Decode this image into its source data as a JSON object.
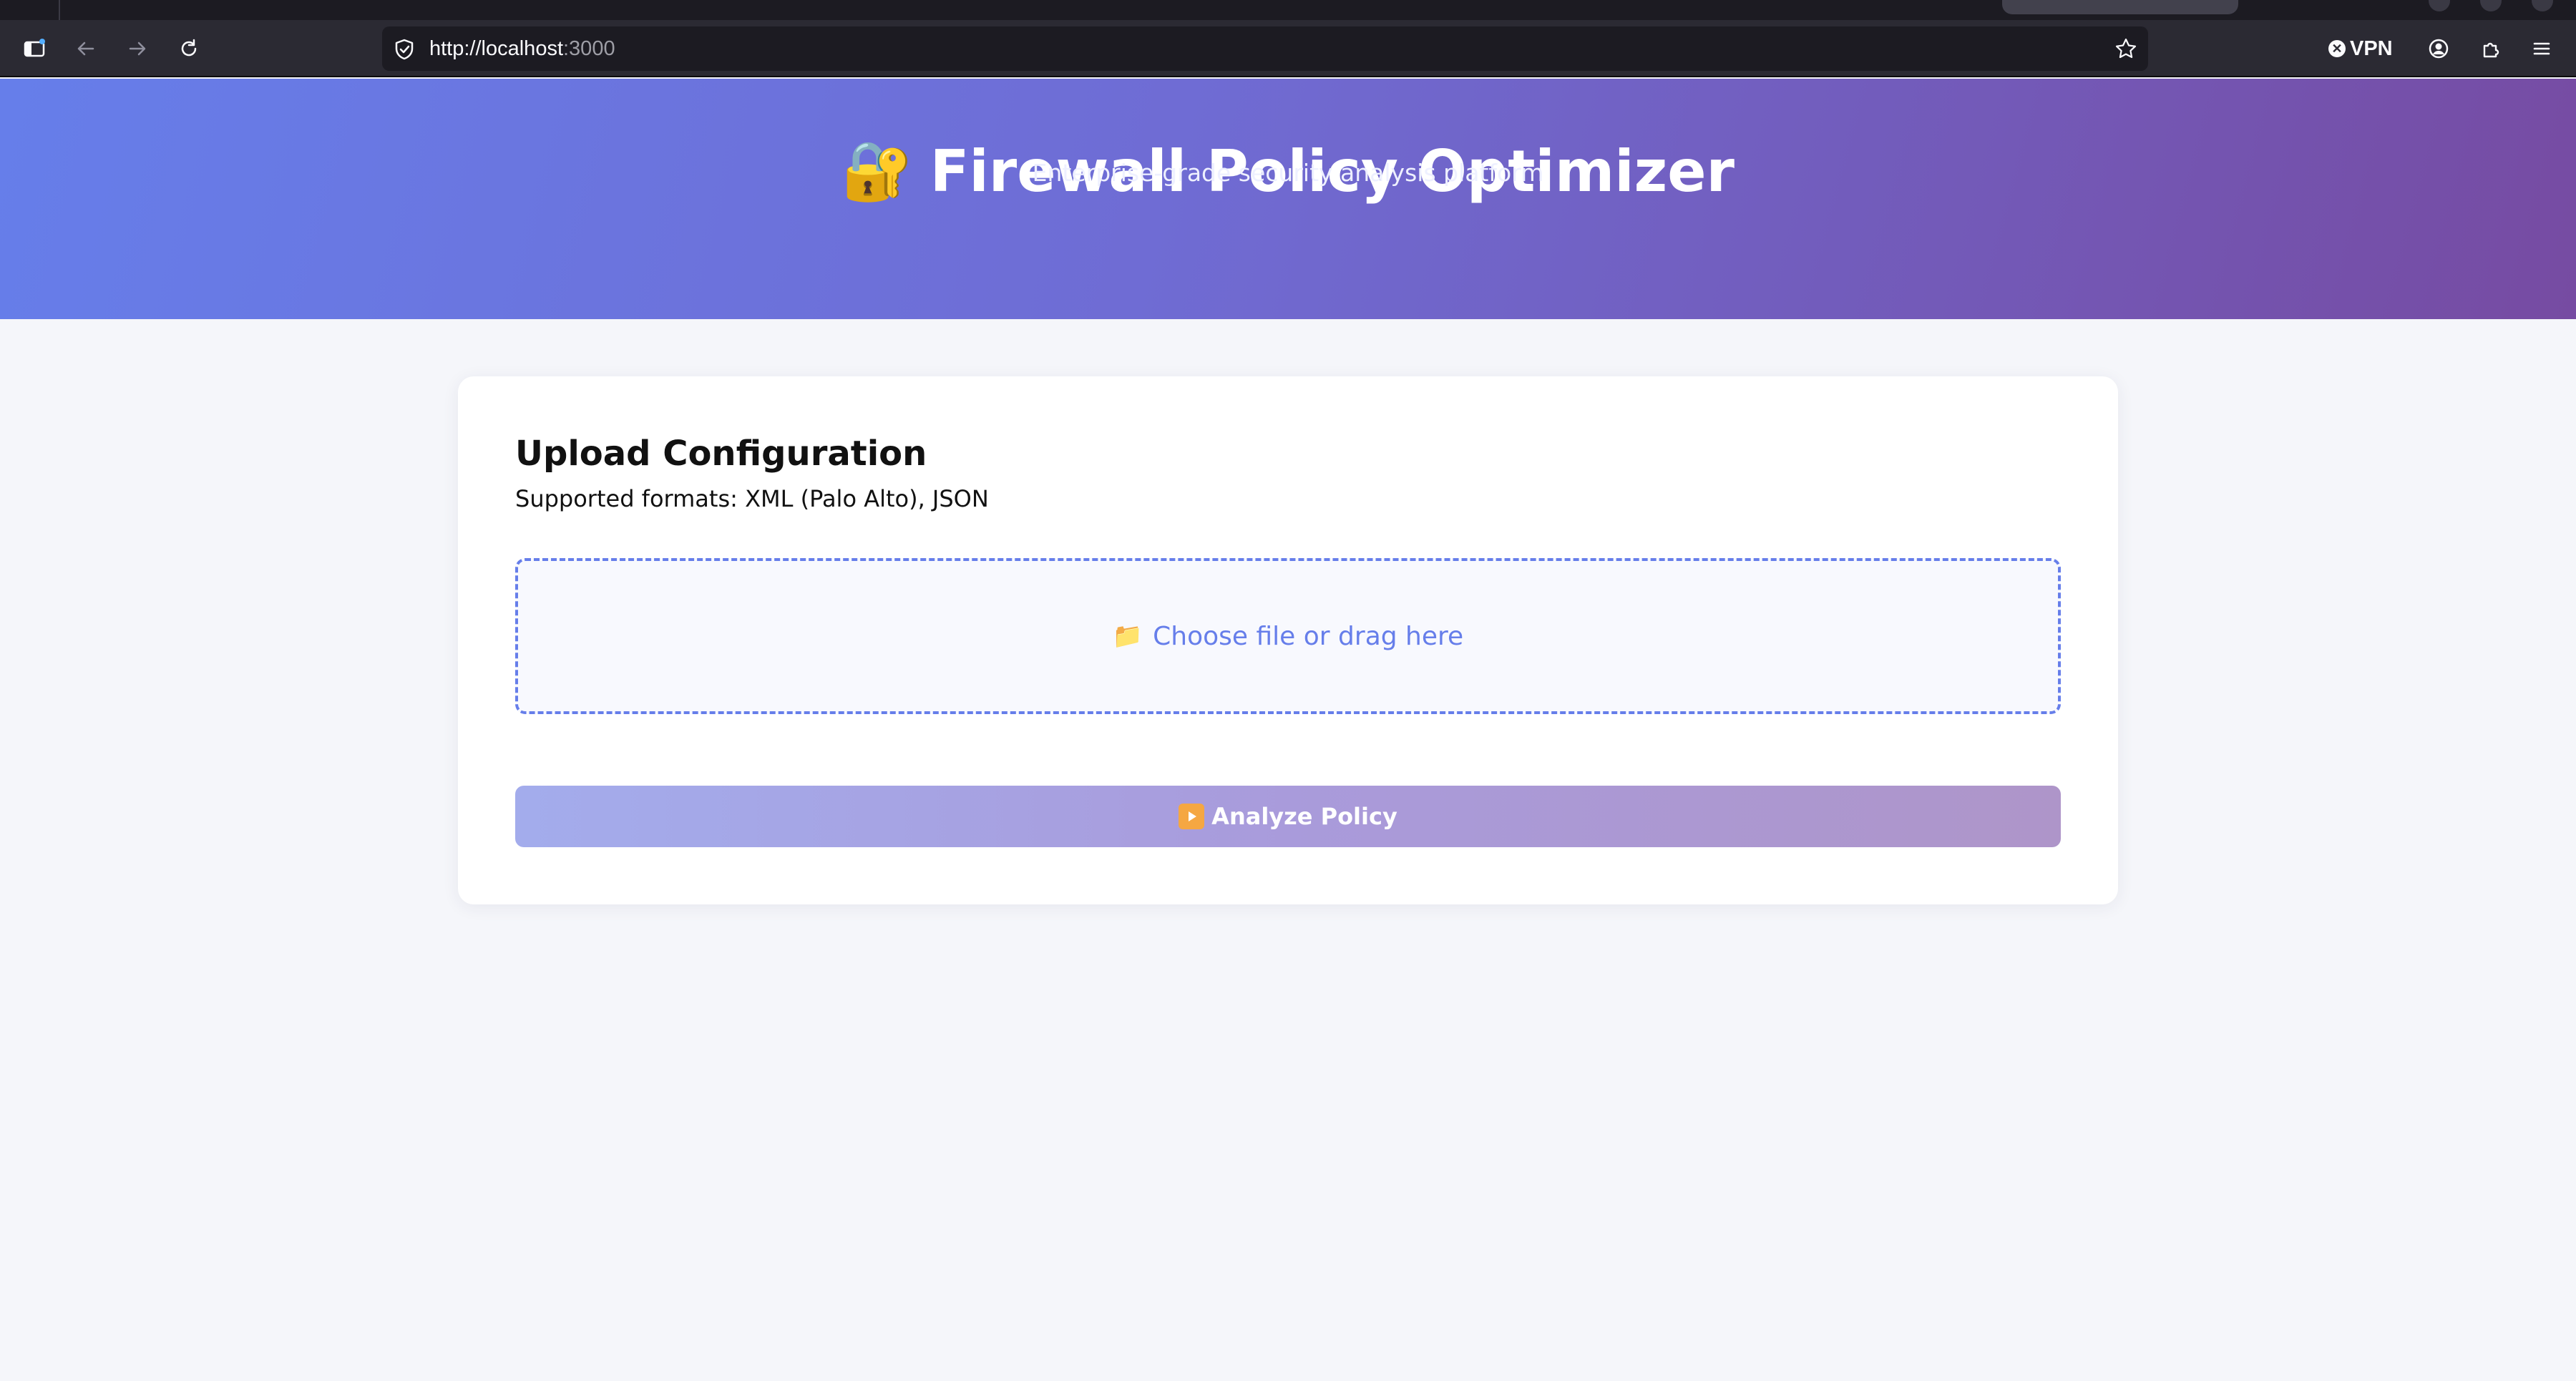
{
  "browser": {
    "url_host": "http://localhost",
    "url_port": ":3000",
    "vpn_label": "VPN",
    "icons": [
      "sidebar-icon",
      "back-icon",
      "forward-icon",
      "reload-icon",
      "shield-icon",
      "bookmark-star-icon",
      "account-icon",
      "extensions-icon",
      "menu-icon"
    ]
  },
  "header": {
    "emoji": "🔐",
    "title": "Firewall Policy Optimizer",
    "subtitle": "Enterprise-grade security analysis platform"
  },
  "upload": {
    "title": "Upload Configuration",
    "formats": "Supported formats: XML (Palo Alto), JSON",
    "dropzone_emoji": "📁",
    "dropzone_label": "Choose file or drag here"
  },
  "actions": {
    "analyze_label": "Analyze Policy"
  },
  "colors": {
    "accent": "#667eea",
    "accent_end": "#764ba2"
  }
}
